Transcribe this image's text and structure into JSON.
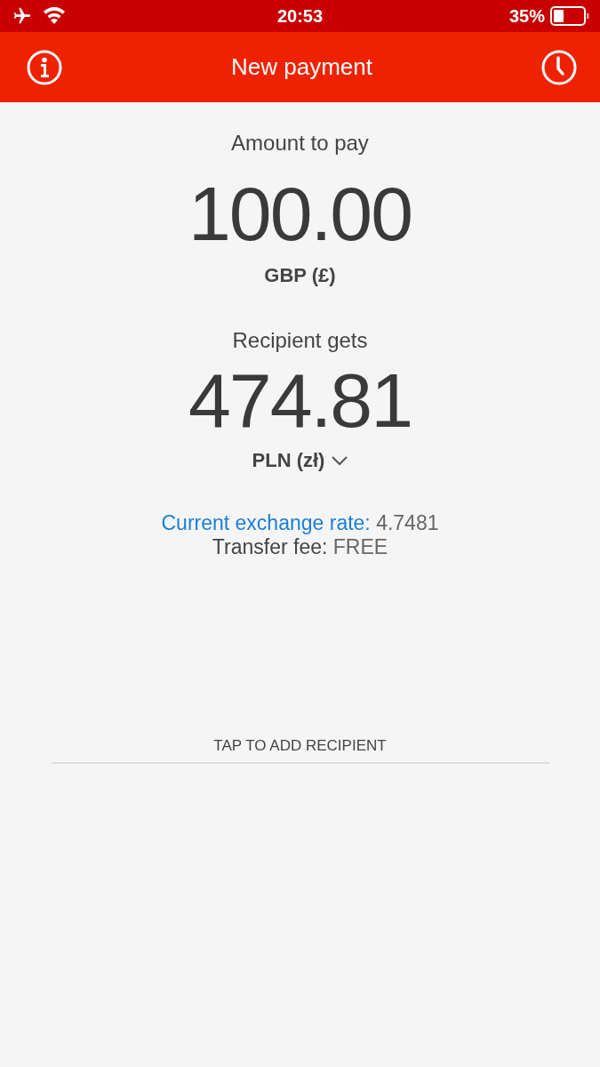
{
  "status_bar": {
    "time": "20:53",
    "battery": "35%"
  },
  "header": {
    "title": "New payment"
  },
  "amount": {
    "label": "Amount to pay",
    "value": "100.00",
    "currency": "GBP (£)"
  },
  "recipient": {
    "label": "Recipient gets",
    "value": "474.81",
    "currency": "PLN (zł)"
  },
  "rate": {
    "label": "Current exchange rate:",
    "value": "4.7481"
  },
  "fee": {
    "label": "Transfer fee:",
    "value": "FREE"
  },
  "add_recipient": {
    "label": "TAP TO ADD RECIPIENT"
  }
}
